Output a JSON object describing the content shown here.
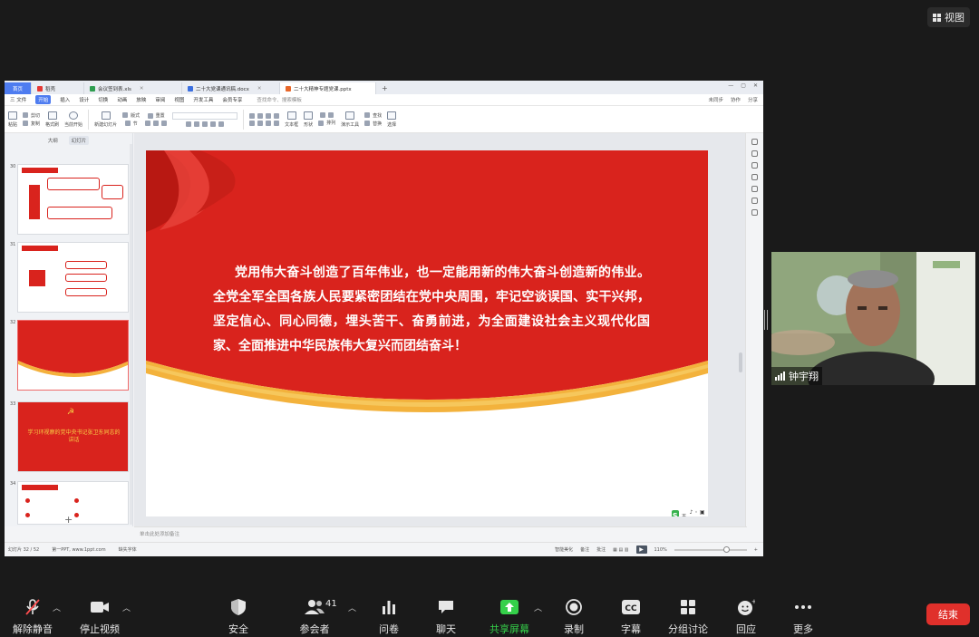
{
  "top": {
    "view_label": "视图"
  },
  "wps": {
    "tabs": [
      {
        "label": "首页"
      },
      {
        "label": "稻壳"
      },
      {
        "label": "会议签到表.xls"
      },
      {
        "label": "二十大党课通讯稿.docx"
      },
      {
        "label": "二十大精神专题党课.pptx"
      }
    ],
    "menu": [
      "三 文件",
      "开始",
      "插入",
      "设计",
      "切换",
      "动画",
      "放映",
      "审阅",
      "视图",
      "开发工具",
      "会员专享"
    ],
    "menu_search": "查找命令、搜索模板",
    "menu_right": [
      "未同步",
      "协作",
      "分享"
    ],
    "ribbon": [
      "粘贴",
      "剪切",
      "复制",
      "格式刷",
      "当前开始",
      "新建幻灯片",
      "版式",
      "节",
      "重置",
      "文本框",
      "形状",
      "排列",
      "演示工具",
      "查找",
      "替换",
      "选择"
    ],
    "left_tabs": [
      "大纲",
      "幻灯片"
    ],
    "slide_nums": [
      "30",
      "31",
      "32",
      "33",
      "34"
    ],
    "thumb33_title": "学习环视察的党中央书记张卫东同志的讲话",
    "slide_text": "党用伟大奋斗创造了百年伟业，也一定能用新的伟大奋斗创造新的伟业。全党全军全国各族人民要紧密团结在党中央周围，牢记空谈误国、实干兴邦，坚定信心、同心同德，埋头苦干、奋勇前进，为全面建设社会主义现代化国家、全面推进中华民族伟大复兴而团结奋斗！",
    "notes_placeholder": "单击此处添加备注",
    "status_left": [
      "幻灯片 32 / 52",
      "第一PPT, www.1ppt.com",
      "缺失字体"
    ],
    "status_right": [
      "智能美化",
      "备注",
      "批注",
      "110%"
    ],
    "badge_label": "五"
  },
  "video": {
    "name": "钟宇翔"
  },
  "toolbar": {
    "items": [
      {
        "label": "解除静音",
        "icon": "mic-muted-icon"
      },
      {
        "label": "停止视频",
        "icon": "video-camera-icon"
      },
      {
        "label": "安全",
        "icon": "shield-icon"
      },
      {
        "label": "参会者",
        "icon": "participants-icon"
      },
      {
        "label": "问卷",
        "icon": "poll-icon"
      },
      {
        "label": "聊天",
        "icon": "chat-icon"
      },
      {
        "label": "共享屏幕",
        "icon": "share-screen-icon"
      },
      {
        "label": "录制",
        "icon": "record-icon"
      },
      {
        "label": "字幕",
        "icon": "cc-icon"
      },
      {
        "label": "分组讨论",
        "icon": "breakout-icon"
      },
      {
        "label": "回应",
        "icon": "reaction-icon"
      },
      {
        "label": "更多",
        "icon": "more-icon"
      }
    ],
    "participants_count": "41",
    "end_label": "结束"
  },
  "colors": {
    "slide_red": "#d9231d",
    "accent_green": "#35d04a",
    "end_red": "#e0302b"
  }
}
